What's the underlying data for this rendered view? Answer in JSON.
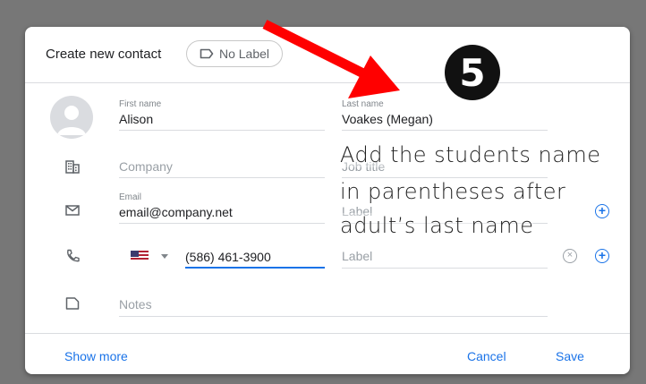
{
  "dialog": {
    "title": "Create new contact",
    "label_chip": "No Label",
    "show_more": "Show more",
    "cancel": "Cancel",
    "save": "Save"
  },
  "fields": {
    "first_name": {
      "label": "First name",
      "value": "Alison"
    },
    "last_name": {
      "label": "Last name",
      "value": "Voakes (Megan)"
    },
    "company": {
      "placeholder": "Company"
    },
    "job_title": {
      "placeholder": "Job title"
    },
    "email": {
      "label": "Email",
      "value": "email@company.net",
      "type_placeholder": "Label"
    },
    "phone": {
      "value": "(586) 461-3900",
      "type_placeholder": "Label"
    },
    "notes": {
      "placeholder": "Notes"
    }
  },
  "annotation": {
    "step_number": "5",
    "lines": [
      "Add the students name",
      "in parentheses after",
      "adult’s last name"
    ],
    "arrow_color": "#ff0000"
  },
  "icons": {
    "avatar": "person-avatar-icon",
    "company": "building-icon",
    "email": "mail-icon",
    "phone": "phone-icon",
    "notes": "note-icon",
    "label": "label-icon",
    "add": "add-circle-icon",
    "clear": "clear-circle-icon",
    "flag": "us-flag-icon"
  },
  "colors": {
    "accent": "#1a73e8",
    "backdrop": "#777777",
    "arrow": "#ff0000"
  }
}
